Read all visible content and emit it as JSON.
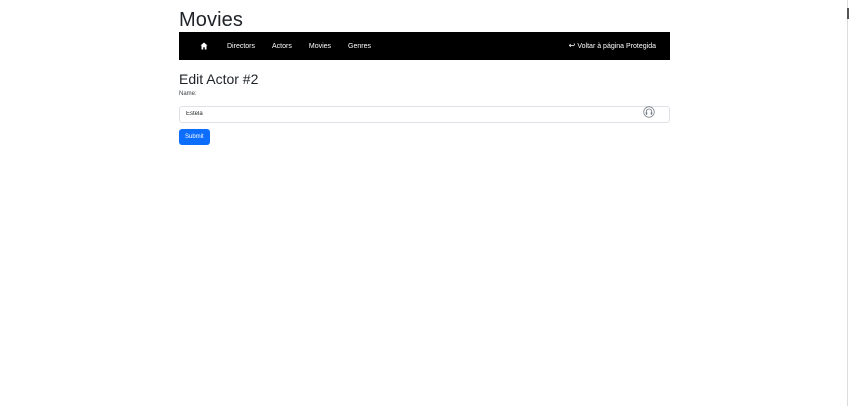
{
  "header": {
    "site_title": "Movies"
  },
  "navbar": {
    "home_icon": "home-icon",
    "links": [
      {
        "label": "Directors"
      },
      {
        "label": "Actors"
      },
      {
        "label": "Movies"
      },
      {
        "label": "Genres"
      }
    ],
    "back_icon": "return-arrow-icon",
    "back_label": "Voltar à página Protegida"
  },
  "main": {
    "heading": "Edit Actor #2",
    "name_label": "Name:",
    "name_value": "Estela",
    "mic_icon": "headset-icon",
    "submit_label": "Submit"
  },
  "colors": {
    "navbar_bg": "#000000",
    "primary_button": "#0d6efd"
  }
}
